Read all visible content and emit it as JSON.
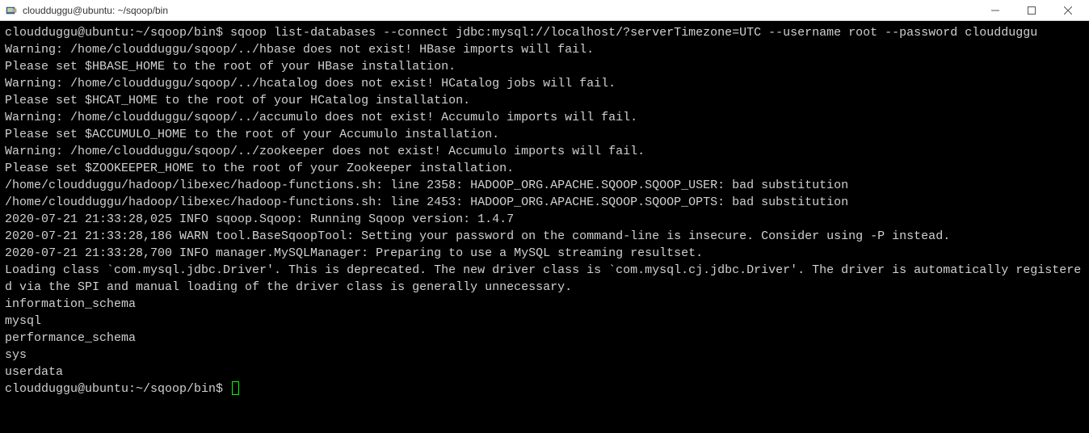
{
  "window": {
    "title": "cloudduggu@ubuntu: ~/sqoop/bin"
  },
  "terminal": {
    "prompt1": "cloudduggu@ubuntu:~/sqoop/bin$ ",
    "command": "sqoop list-databases --connect jdbc:mysql://localhost/?serverTimezone=UTC --username root --password cloudduggu",
    "lines": [
      "Warning: /home/cloudduggu/sqoop/../hbase does not exist! HBase imports will fail.",
      "Please set $HBASE_HOME to the root of your HBase installation.",
      "Warning: /home/cloudduggu/sqoop/../hcatalog does not exist! HCatalog jobs will fail.",
      "Please set $HCAT_HOME to the root of your HCatalog installation.",
      "Warning: /home/cloudduggu/sqoop/../accumulo does not exist! Accumulo imports will fail.",
      "Please set $ACCUMULO_HOME to the root of your Accumulo installation.",
      "Warning: /home/cloudduggu/sqoop/../zookeeper does not exist! Accumulo imports will fail.",
      "Please set $ZOOKEEPER_HOME to the root of your Zookeeper installation.",
      "/home/cloudduggu/hadoop/libexec/hadoop-functions.sh: line 2358: HADOOP_ORG.APACHE.SQOOP.SQOOP_USER: bad substitution",
      "/home/cloudduggu/hadoop/libexec/hadoop-functions.sh: line 2453: HADOOP_ORG.APACHE.SQOOP.SQOOP_OPTS: bad substitution",
      "2020-07-21 21:33:28,025 INFO sqoop.Sqoop: Running Sqoop version: 1.4.7",
      "2020-07-21 21:33:28,186 WARN tool.BaseSqoopTool: Setting your password on the command-line is insecure. Consider using -P instead.",
      "2020-07-21 21:33:28,700 INFO manager.MySQLManager: Preparing to use a MySQL streaming resultset.",
      "Loading class `com.mysql.jdbc.Driver'. This is deprecated. The new driver class is `com.mysql.cj.jdbc.Driver'. The driver is automatically registered via the SPI and manual loading of the driver class is generally unnecessary.",
      "information_schema",
      "mysql",
      "performance_schema",
      "sys",
      "userdata"
    ],
    "prompt2": "cloudduggu@ubuntu:~/sqoop/bin$ "
  }
}
